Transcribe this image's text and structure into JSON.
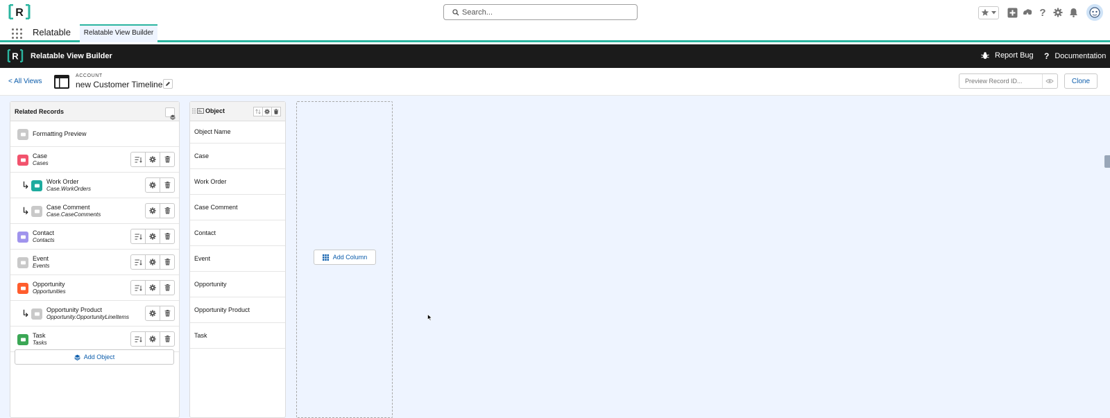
{
  "global_header": {
    "logo_text": "R",
    "search": {
      "placeholder": "Search...",
      "value": ""
    },
    "icons": [
      "favorites-star-icon",
      "favorites-dropdown-icon",
      "global-add-icon",
      "trailhead-icon",
      "help-icon",
      "setup-gear-icon",
      "notifications-bell-icon",
      "user-avatar"
    ]
  },
  "app_nav": {
    "app_name": "Relatable",
    "tabs": [
      {
        "label": "Relatable View Builder",
        "active": true
      }
    ]
  },
  "builder_bar": {
    "title": "Relatable View Builder",
    "report_bug": "Report Bug",
    "documentation": "Documentation"
  },
  "view_header": {
    "back_link": "< All Views",
    "kicker": "ACCOUNT",
    "view_name": "new Customer Timeline",
    "preview_placeholder": "Preview Record ID...",
    "clone_label": "Clone"
  },
  "related_records": {
    "title": "Related Records",
    "rows": [
      {
        "name": "Formatting Preview",
        "sub": "",
        "indent": false,
        "icon_color": "#c9c9c9",
        "icon": "formatting-preview-icon",
        "sort": false,
        "settings": false,
        "delete": false
      },
      {
        "name": "Case",
        "sub": "Cases",
        "indent": false,
        "icon_color": "#f2536d",
        "icon": "case-icon",
        "sort": true,
        "settings": true,
        "delete": true
      },
      {
        "name": "Work Order",
        "sub": "Case.WorkOrders",
        "indent": true,
        "icon_color": "#1eab9e",
        "icon": "work-order-icon",
        "sort": false,
        "settings": true,
        "delete": true
      },
      {
        "name": "Case Comment",
        "sub": "Case.CaseComments",
        "indent": true,
        "icon_color": "#c9c9c9",
        "icon": "case-comment-icon",
        "sort": false,
        "settings": true,
        "delete": true
      },
      {
        "name": "Contact",
        "sub": "Contacts",
        "indent": false,
        "icon_color": "#a094ed",
        "icon": "contact-icon",
        "sort": true,
        "settings": true,
        "delete": true
      },
      {
        "name": "Event",
        "sub": "Events",
        "indent": false,
        "icon_color": "#c9c9c9",
        "icon": "event-icon",
        "sort": true,
        "settings": true,
        "delete": true
      },
      {
        "name": "Opportunity",
        "sub": "Opportunities",
        "indent": false,
        "icon_color": "#ff5d2d",
        "icon": "opportunity-icon",
        "sort": true,
        "settings": true,
        "delete": true
      },
      {
        "name": "Opportunity Product",
        "sub": "Opportunity.OpportunityLineItems",
        "indent": true,
        "icon_color": "#c9c9c9",
        "icon": "opportunity-product-icon",
        "sort": false,
        "settings": true,
        "delete": true
      },
      {
        "name": "Task",
        "sub": "Tasks",
        "indent": false,
        "icon_color": "#3ba755",
        "icon": "task-icon",
        "sort": true,
        "settings": true,
        "delete": true
      }
    ],
    "add_object_label": "Add Object"
  },
  "object_column": {
    "title": "Object",
    "cells": [
      "Object Name",
      "Case",
      "Work Order",
      "Case Comment",
      "Contact",
      "Event",
      "Opportunity",
      "Opportunity Product",
      "Task"
    ]
  },
  "drop_zone": {
    "add_column_label": "Add Column"
  },
  "colors": {
    "accent_teal": "#2bb5a0",
    "link_blue": "#0b5cab",
    "dark_bar": "#1b1b1b",
    "canvas_bg": "#eef4ff"
  }
}
